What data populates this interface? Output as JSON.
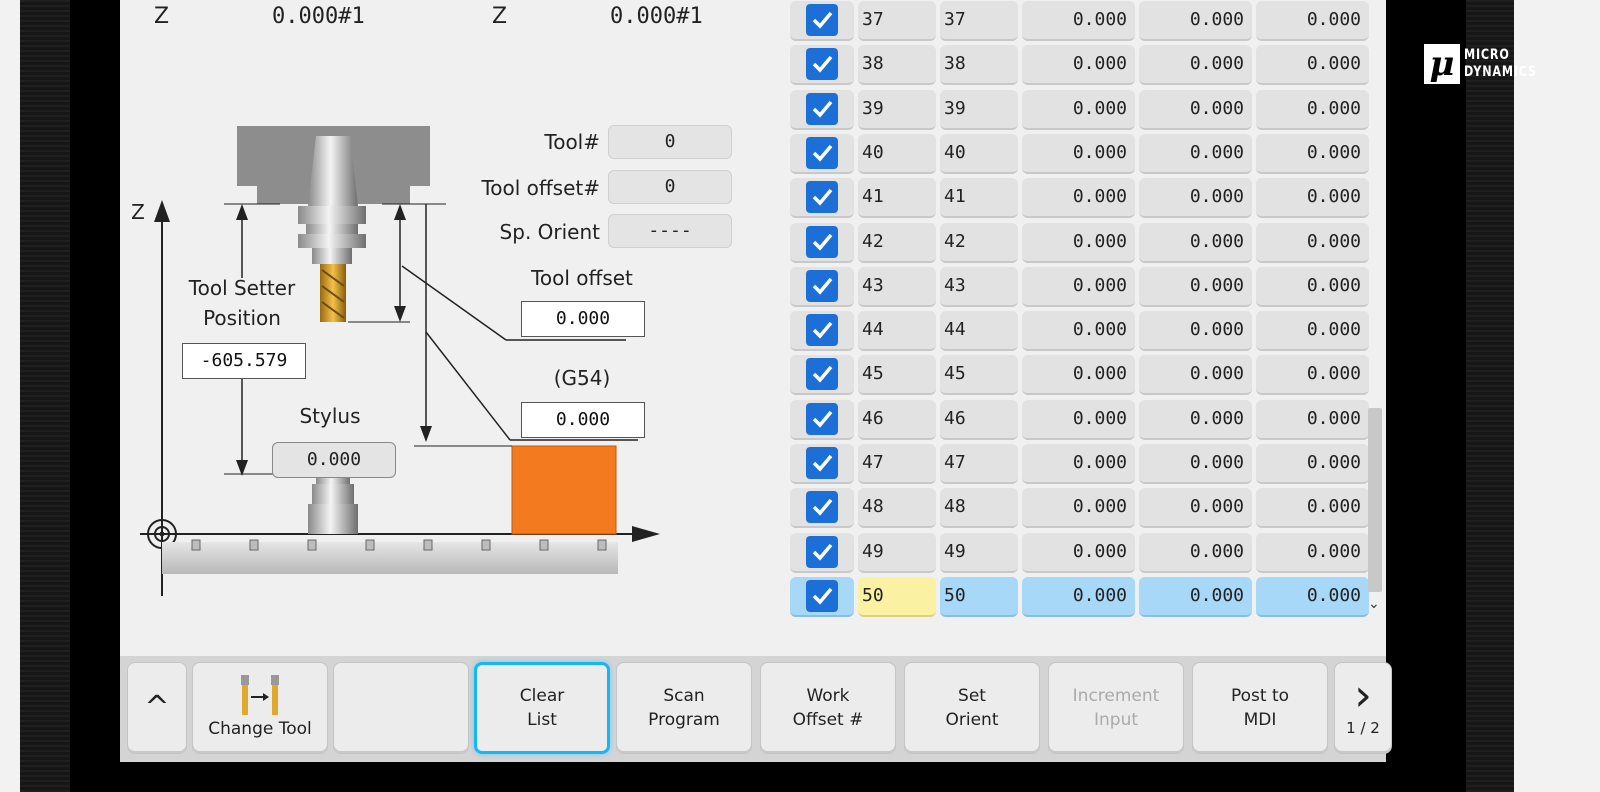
{
  "coords": {
    "left_axis": "Z",
    "left_value": "0.000#1",
    "right_axis": "Z",
    "right_value": "0.000#1"
  },
  "fields": {
    "tool_num_label": "Tool#",
    "tool_num_value": "0",
    "tool_offset_num_label": "Tool offset#",
    "tool_offset_num_value": "0",
    "sp_orient_label": "Sp. Orient",
    "sp_orient_value": "----"
  },
  "diagram": {
    "z_axis_label": "Z",
    "tool_setter_label_1": "Tool Setter",
    "tool_setter_label_2": "Position",
    "tool_setter_value": "-605.579",
    "stylus_label": "Stylus",
    "stylus_value": "0.000",
    "tool_offset_label": "Tool offset",
    "tool_offset_value": "0.000",
    "work_offset_label": "(G54)",
    "work_offset_value": "0.000",
    "workpiece_color": "#f47a1f",
    "table_color": "#c8c8c8"
  },
  "table": {
    "rows": [
      {
        "n1": "37",
        "n2": "37",
        "v1": "0.000",
        "v2": "0.000",
        "v3": "0.000"
      },
      {
        "n1": "38",
        "n2": "38",
        "v1": "0.000",
        "v2": "0.000",
        "v3": "0.000"
      },
      {
        "n1": "39",
        "n2": "39",
        "v1": "0.000",
        "v2": "0.000",
        "v3": "0.000"
      },
      {
        "n1": "40",
        "n2": "40",
        "v1": "0.000",
        "v2": "0.000",
        "v3": "0.000"
      },
      {
        "n1": "41",
        "n2": "41",
        "v1": "0.000",
        "v2": "0.000",
        "v3": "0.000"
      },
      {
        "n1": "42",
        "n2": "42",
        "v1": "0.000",
        "v2": "0.000",
        "v3": "0.000"
      },
      {
        "n1": "43",
        "n2": "43",
        "v1": "0.000",
        "v2": "0.000",
        "v3": "0.000"
      },
      {
        "n1": "44",
        "n2": "44",
        "v1": "0.000",
        "v2": "0.000",
        "v3": "0.000"
      },
      {
        "n1": "45",
        "n2": "45",
        "v1": "0.000",
        "v2": "0.000",
        "v3": "0.000"
      },
      {
        "n1": "46",
        "n2": "46",
        "v1": "0.000",
        "v2": "0.000",
        "v3": "0.000"
      },
      {
        "n1": "47",
        "n2": "47",
        "v1": "0.000",
        "v2": "0.000",
        "v3": "0.000"
      },
      {
        "n1": "48",
        "n2": "48",
        "v1": "0.000",
        "v2": "0.000",
        "v3": "0.000"
      },
      {
        "n1": "49",
        "n2": "49",
        "v1": "0.000",
        "v2": "0.000",
        "v3": "0.000"
      },
      {
        "n1": "50",
        "n2": "50",
        "v1": "0.000",
        "v2": "0.000",
        "v3": "0.000"
      }
    ],
    "selected_row": "50",
    "selected_color": "#a8d8f8",
    "selected_cell_color": "#fbf1a2",
    "checkbox_color": "#1b6fd6"
  },
  "softkeys": {
    "up": "^",
    "change_tool": "Change Tool",
    "clear_list_1": "Clear",
    "clear_list_2": "List",
    "scan_program_1": "Scan",
    "scan_program_2": "Program",
    "work_offset_1": "Work",
    "work_offset_2": "Offset #",
    "set_orient_1": "Set",
    "set_orient_2": "Orient",
    "increment_input_1": "Increment",
    "increment_input_2": "Input",
    "post_mdi_1": "Post to",
    "post_mdi_2": "MDI",
    "next": "›",
    "page": "1 / 2",
    "active_color": "#19b6f2"
  }
}
